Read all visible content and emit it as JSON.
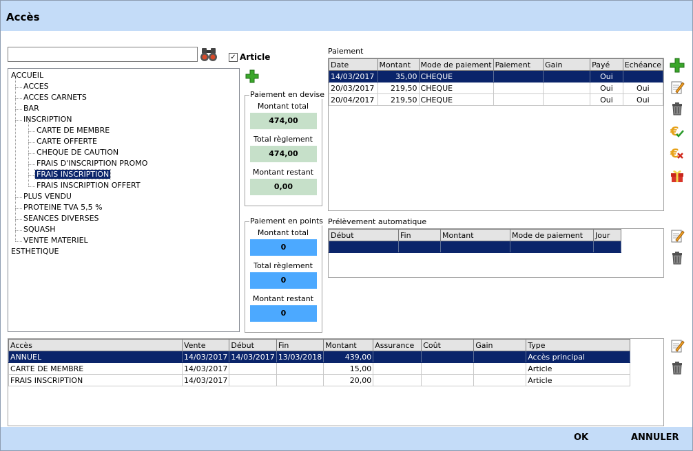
{
  "window": {
    "title": "Accès"
  },
  "search": {
    "value": "",
    "placeholder": ""
  },
  "filter": {
    "checked": true,
    "label": "Article"
  },
  "tree": {
    "root1": "ACCUEIL",
    "children": [
      "ACCES",
      "ACCES CARNETS",
      "BAR",
      "INSCRIPTION"
    ],
    "inscription_children": [
      "CARTE DE MEMBRE",
      "CARTE OFFERTE",
      "CHEQUE DE CAUTION",
      "FRAIS D'INSCRIPTION PROMO",
      "FRAIS INSCRIPTION",
      "FRAIS INSCRIPTION OFFERT"
    ],
    "after": [
      "PLUS VENDU",
      "PROTEINE TVA 5,5 %",
      "SEANCES DIVERSES",
      "SQUASH",
      "VENTE MATERIEL"
    ],
    "root2": "ESTHETIQUE",
    "selected": "FRAIS INSCRIPTION"
  },
  "paiement_devise": {
    "title": "Paiement en devise",
    "montant_total_label": "Montant total",
    "montant_total": "474,00",
    "total_reglement_label": "Total règlement",
    "total_reglement": "474,00",
    "montant_restant_label": "Montant restant",
    "montant_restant": "0,00"
  },
  "paiement_points": {
    "title": "Paiement en points",
    "montant_total_label": "Montant total",
    "montant_total": "0",
    "total_reglement_label": "Total règlement",
    "total_reglement": "0",
    "montant_restant_label": "Montant restant",
    "montant_restant": "0"
  },
  "paiement": {
    "label": "Paiement",
    "columns": [
      "Date",
      "Montant",
      "Mode de paiement",
      "Paiement",
      "Gain",
      "Payé",
      "Echéance"
    ],
    "rows": [
      [
        "14/03/2017",
        "35,00",
        "CHEQUE",
        "",
        "",
        "Oui",
        ""
      ],
      [
        "20/03/2017",
        "219,50",
        "CHEQUE",
        "",
        "",
        "Oui",
        "Oui"
      ],
      [
        "20/04/2017",
        "219,50",
        "CHEQUE",
        "",
        "",
        "Oui",
        "Oui"
      ]
    ]
  },
  "prelevement": {
    "label": "Prélèvement automatique",
    "columns": [
      "Début",
      "Fin",
      "Montant",
      "Mode de paiement",
      "Jour"
    ]
  },
  "acces_table": {
    "columns": [
      "Accès",
      "Vente",
      "Début",
      "Fin",
      "Montant",
      "Assurance",
      "Coût",
      "Gain",
      "Type"
    ],
    "rows": [
      [
        "ANNUEL",
        "14/03/2017",
        "14/03/2017",
        "13/03/2018",
        "439,00",
        "",
        "",
        "",
        "Accès principal"
      ],
      [
        "CARTE DE MEMBRE",
        "14/03/2017",
        "",
        "",
        "15,00",
        "",
        "",
        "",
        "Article"
      ],
      [
        "FRAIS INSCRIPTION",
        "14/03/2017",
        "",
        "",
        "20,00",
        "",
        "",
        "",
        "Article"
      ]
    ]
  },
  "footer": {
    "ok": "OK",
    "cancel": "ANNULER"
  },
  "colors": {
    "title_bg": "#c4dcf8",
    "selection": "#0a246a",
    "green_box": "#c6e0c9",
    "blue_box": "#4ca9ff"
  },
  "icons": [
    "binoculars-icon",
    "plus-icon",
    "edit-icon",
    "trash-icon",
    "euro-check-icon",
    "euro-cancel-icon",
    "gift-icon"
  ]
}
